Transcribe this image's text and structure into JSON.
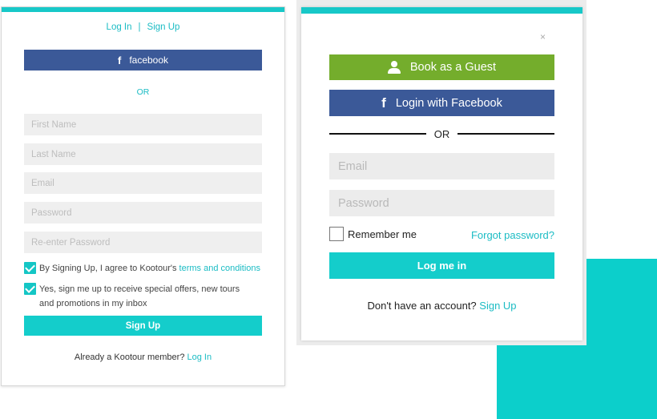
{
  "signup_panel": {
    "tab_login": "Log In",
    "tab_separator": "|",
    "tab_signup": "Sign Up",
    "facebook_label": "facebook",
    "or_label": "OR",
    "fields": {
      "first_name": "First Name",
      "last_name": "Last Name",
      "email": "Email",
      "password": "Password",
      "reenter_password": "Re-enter Password"
    },
    "terms_text": "By Signing Up, I agree to Kootour's ",
    "terms_link": "terms and conditions",
    "offers_text": "Yes, sign me up to receive special offers, new tours and promotions in my inbox",
    "signup_button": "Sign Up",
    "member_text": "Already a Kootour member? ",
    "member_link": "Log In"
  },
  "login_panel": {
    "close_label": "×",
    "guest_button": "Book as a Guest",
    "facebook_button": "Login with Facebook",
    "or_label": "OR",
    "fields": {
      "email": "Email",
      "password": "Password"
    },
    "remember_label": "Remember me",
    "forgot_link": "Forgot password?",
    "login_button": "Log me in",
    "no_account_text": "Don't have an account? ",
    "signup_link": "Sign Up"
  },
  "colors": {
    "accent": "#14cdcb",
    "facebook": "#3b5998",
    "guest": "#74ad2c",
    "link": "#1bbcc4"
  },
  "icons": [
    "facebook-icon",
    "person-icon",
    "checkmark-icon",
    "close-icon"
  ]
}
